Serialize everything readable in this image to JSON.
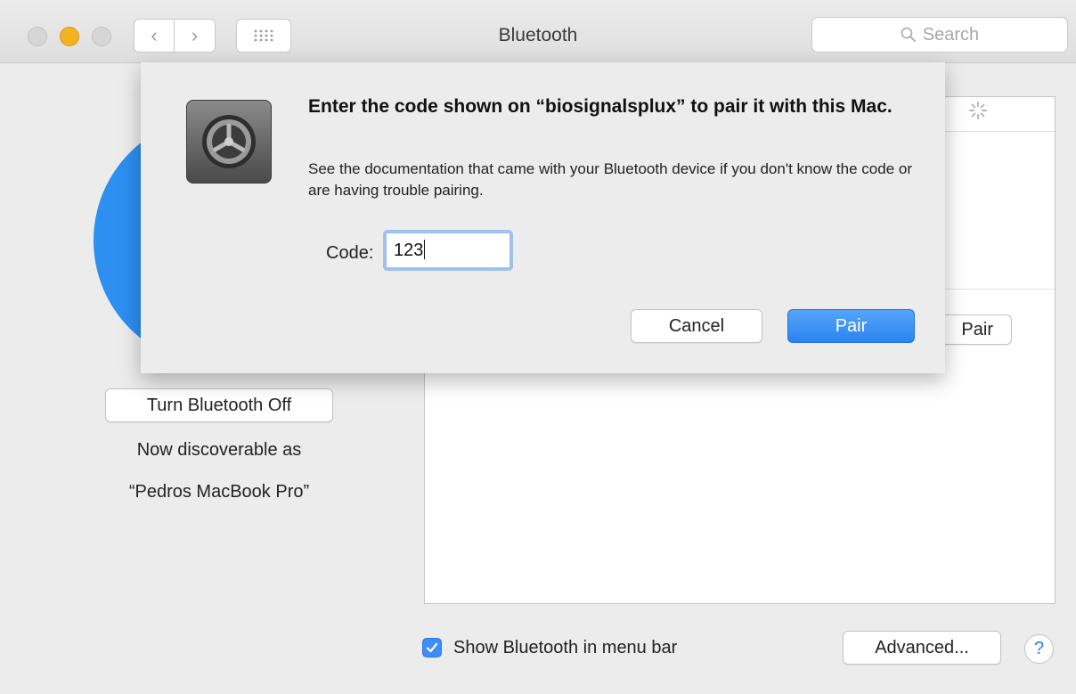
{
  "window": {
    "title": "Bluetooth"
  },
  "toolbar": {
    "back_label": "‹",
    "forward_label": "›",
    "search_placeholder": "Search"
  },
  "left": {
    "turn_off_label": "Turn Bluetooth Off",
    "status_line1": "Now discoverable as",
    "status_line2": "“Pedros MacBook Pro”"
  },
  "devices_panel": {
    "pair_label": "Pair"
  },
  "bottom": {
    "show_in_menubar_label": "Show Bluetooth in menu bar",
    "show_in_menubar_checked": true,
    "advanced_label": "Advanced...",
    "help_label": "?"
  },
  "dialog": {
    "title": "Enter the code shown on “biosignalsplux” to pair it with this Mac.",
    "message": "See the documentation that came with your Bluetooth device if you don't know the code or are having trouble pairing.",
    "code_label": "Code:",
    "code_value": "123",
    "cancel_label": "Cancel",
    "pair_label": "Pair"
  },
  "colors": {
    "accent": "#2a84f1",
    "bluetooth_blue": "#2d8ff0",
    "traffic_minimize": "#f4b120"
  }
}
